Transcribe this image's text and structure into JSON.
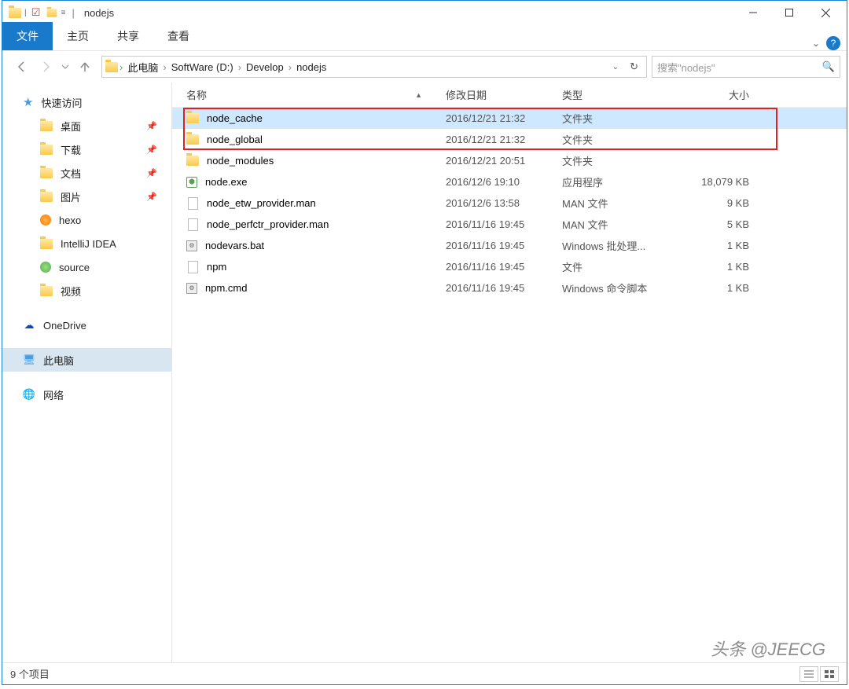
{
  "titlebar": {
    "title": "nodejs"
  },
  "ribbon": {
    "tabs": [
      "文件",
      "主页",
      "共享",
      "查看"
    ],
    "active_index": 0
  },
  "breadcrumbs": [
    "此电脑",
    "SoftWare (D:)",
    "Develop",
    "nodejs"
  ],
  "search": {
    "placeholder": "搜索\"nodejs\""
  },
  "sidebar": {
    "quick_access": {
      "label": "快速访问",
      "items": [
        {
          "label": "桌面",
          "pinned": true,
          "icon": "desktop"
        },
        {
          "label": "下载",
          "pinned": true,
          "icon": "downloads"
        },
        {
          "label": "文档",
          "pinned": true,
          "icon": "documents"
        },
        {
          "label": "图片",
          "pinned": true,
          "icon": "pictures"
        },
        {
          "label": "hexo",
          "pinned": false,
          "icon": "orange"
        },
        {
          "label": "IntelliJ IDEA",
          "pinned": false,
          "icon": "folder"
        },
        {
          "label": "source",
          "pinned": false,
          "icon": "green"
        },
        {
          "label": "视频",
          "pinned": false,
          "icon": "folder"
        }
      ]
    },
    "onedrive": {
      "label": "OneDrive"
    },
    "this_pc": {
      "label": "此电脑"
    },
    "network": {
      "label": "网络"
    }
  },
  "columns": {
    "name": "名称",
    "date": "修改日期",
    "type": "类型",
    "size": "大小"
  },
  "files": [
    {
      "name": "node_cache",
      "date": "2016/12/21 21:32",
      "type": "文件夹",
      "size": "",
      "icon": "folder",
      "selected": true,
      "boxed": true
    },
    {
      "name": "node_global",
      "date": "2016/12/21 21:32",
      "type": "文件夹",
      "size": "",
      "icon": "folder",
      "boxed": true
    },
    {
      "name": "node_modules",
      "date": "2016/12/21 20:51",
      "type": "文件夹",
      "size": "",
      "icon": "folder"
    },
    {
      "name": "node.exe",
      "date": "2016/12/6 19:10",
      "type": "应用程序",
      "size": "18,079 KB",
      "icon": "exe"
    },
    {
      "name": "node_etw_provider.man",
      "date": "2016/12/6 13:58",
      "type": "MAN 文件",
      "size": "9 KB",
      "icon": "file"
    },
    {
      "name": "node_perfctr_provider.man",
      "date": "2016/11/16 19:45",
      "type": "MAN 文件",
      "size": "5 KB",
      "icon": "file"
    },
    {
      "name": "nodevars.bat",
      "date": "2016/11/16 19:45",
      "type": "Windows 批处理...",
      "size": "1 KB",
      "icon": "bat"
    },
    {
      "name": "npm",
      "date": "2016/11/16 19:45",
      "type": "文件",
      "size": "1 KB",
      "icon": "file"
    },
    {
      "name": "npm.cmd",
      "date": "2016/11/16 19:45",
      "type": "Windows 命令脚本",
      "size": "1 KB",
      "icon": "bat"
    }
  ],
  "statusbar": {
    "count_label": "9 个项目"
  },
  "watermark": "头条 @JEECG"
}
